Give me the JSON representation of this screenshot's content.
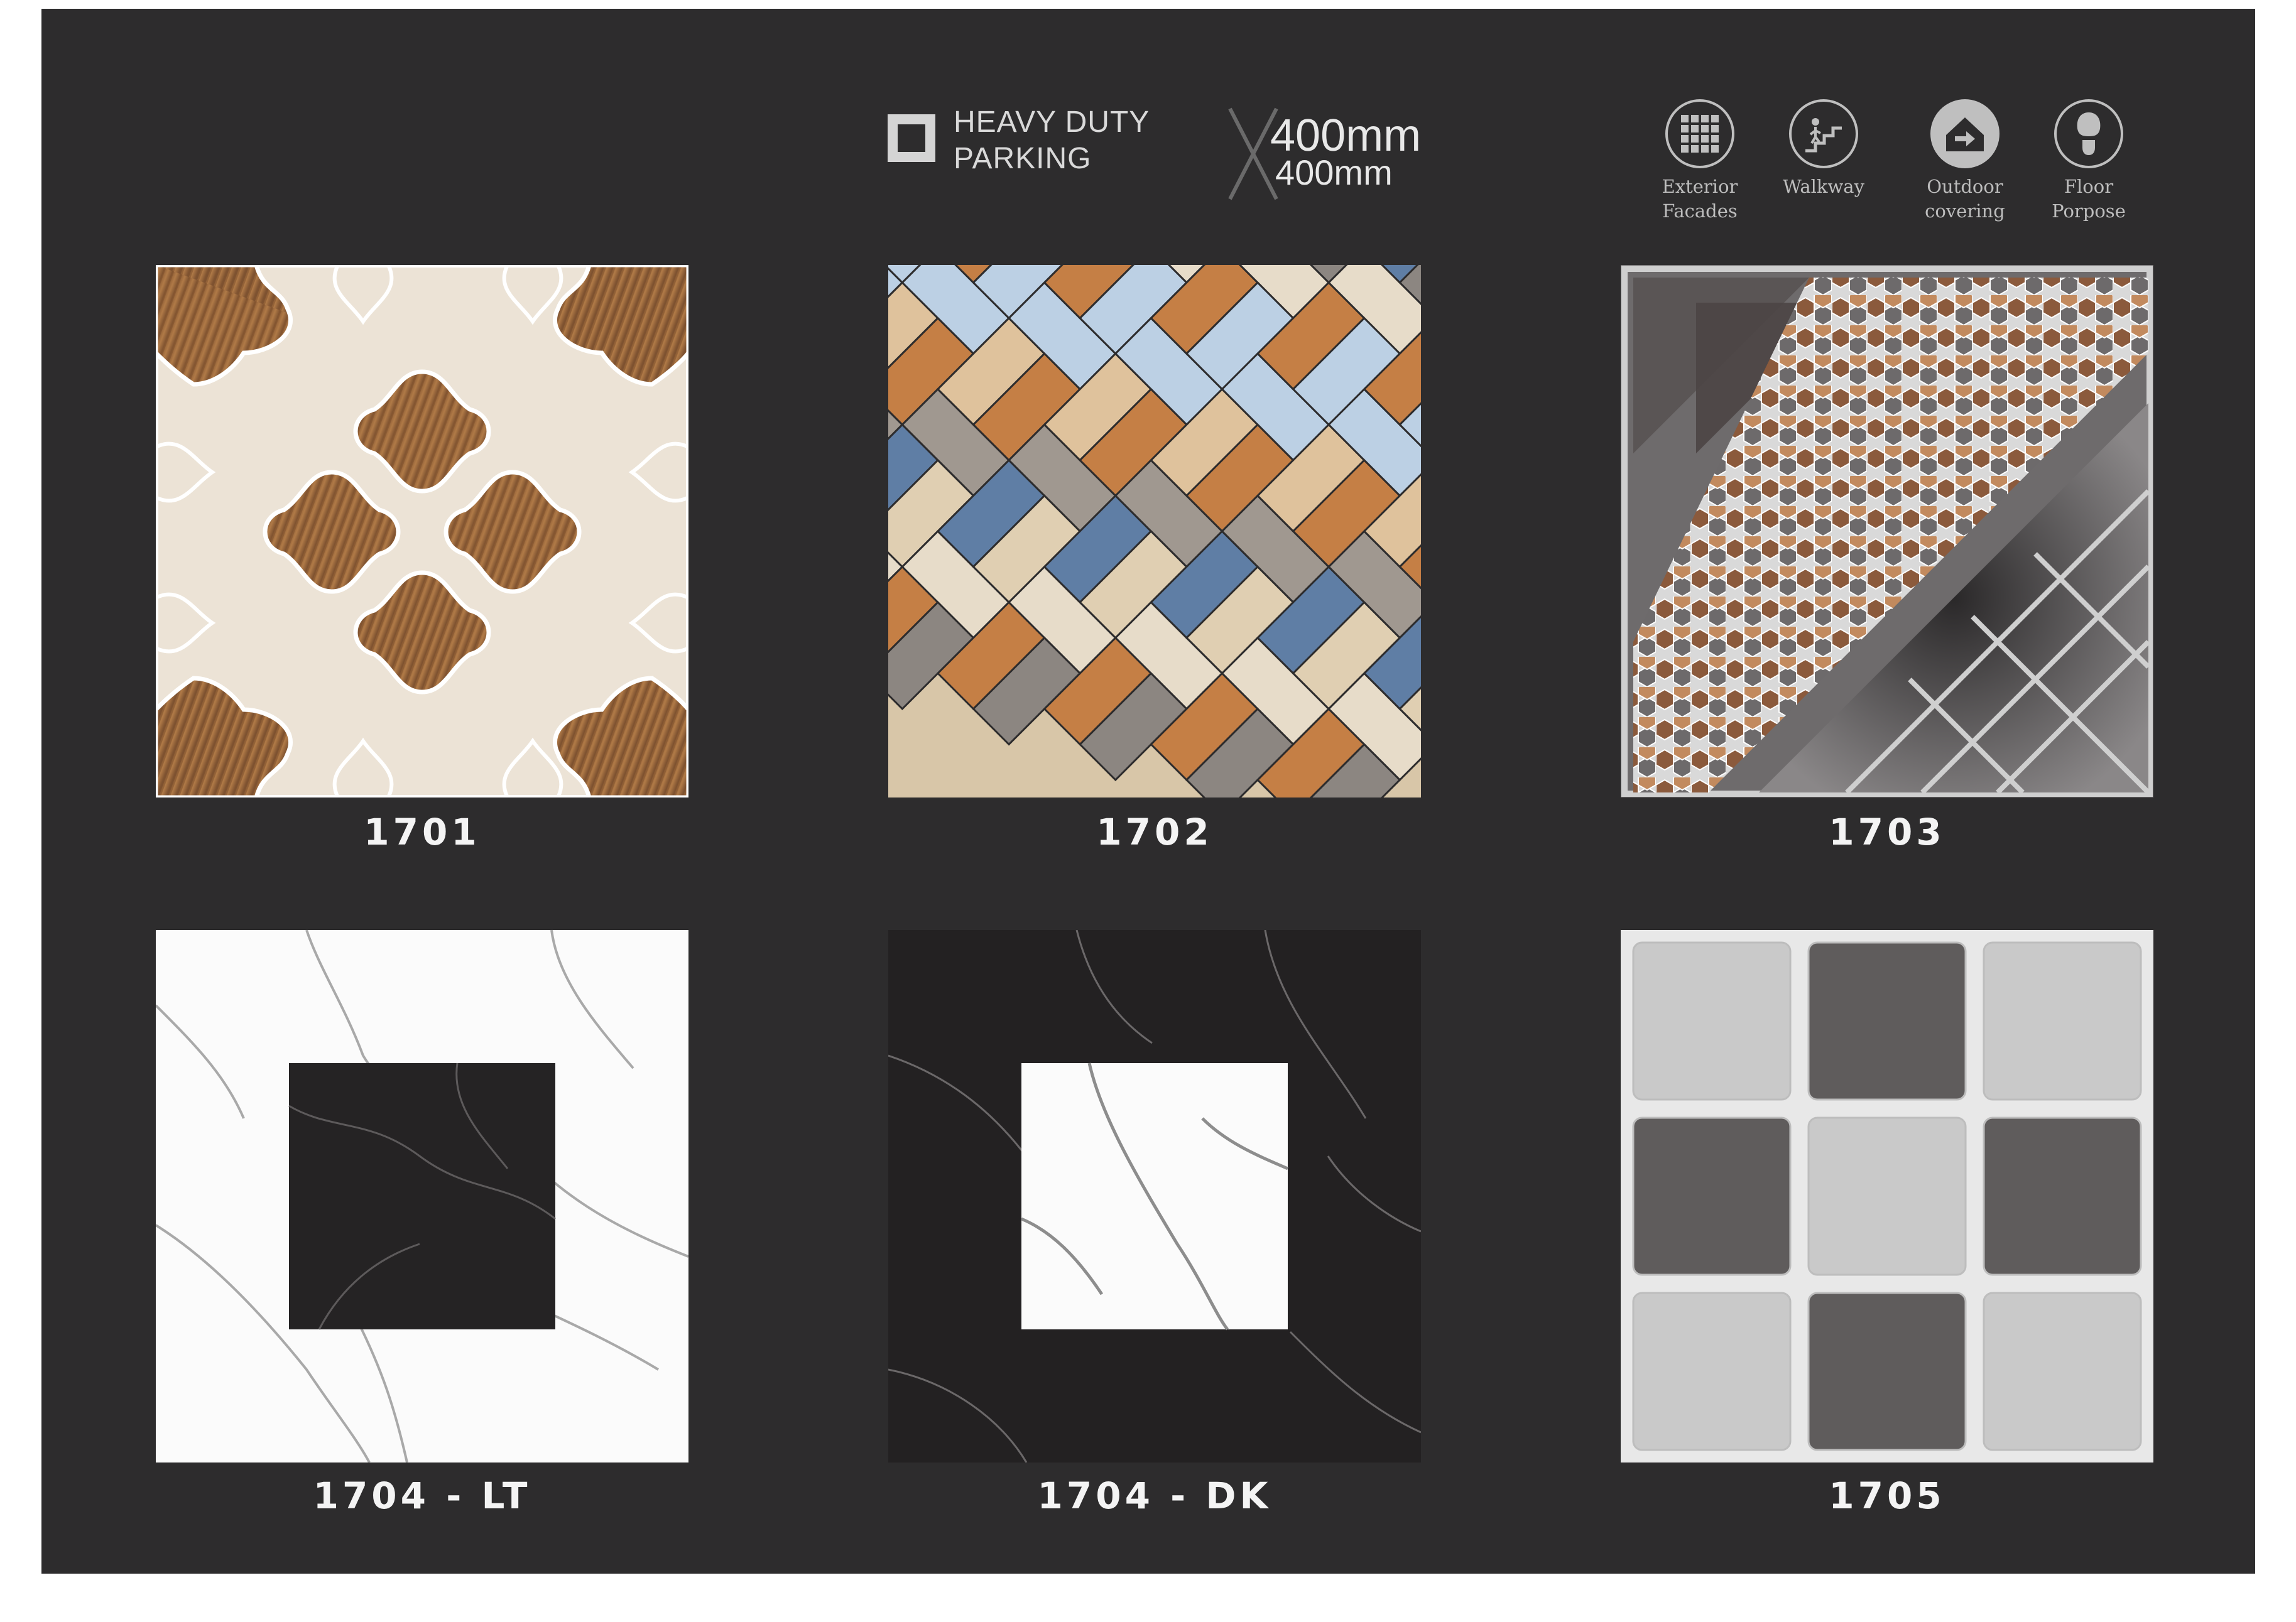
{
  "header": {
    "category_lines": [
      "HEAVY DUTY",
      "PARKING"
    ],
    "size": {
      "width": "400mm",
      "height": "400mm"
    },
    "applications": [
      {
        "icon": "grid-facade-icon",
        "label": "Exterior\nFacades"
      },
      {
        "icon": "walkway-stairs-icon",
        "label": "Walkway"
      },
      {
        "icon": "outdoor-house-icon",
        "label": "Outdoor\ncovering"
      },
      {
        "icon": "footprint-icon",
        "label": "Floor\nPorpose"
      }
    ]
  },
  "tiles": [
    {
      "code": "1701",
      "pattern": "wood-arabesque"
    },
    {
      "code": "1702",
      "pattern": "wood-basketweave"
    },
    {
      "code": "1703",
      "pattern": "grey-diamond-mosaic"
    },
    {
      "code": "1704 - LT",
      "pattern": "white-marble-dark-inset"
    },
    {
      "code": "1704 - DK",
      "pattern": "dark-marble-white-inset"
    },
    {
      "code": "1705",
      "pattern": "grey-checker-squares"
    }
  ],
  "colors": {
    "panel": "#2d2c2d",
    "text": "#f4f4f4",
    "icon": "#bfbfbf"
  }
}
